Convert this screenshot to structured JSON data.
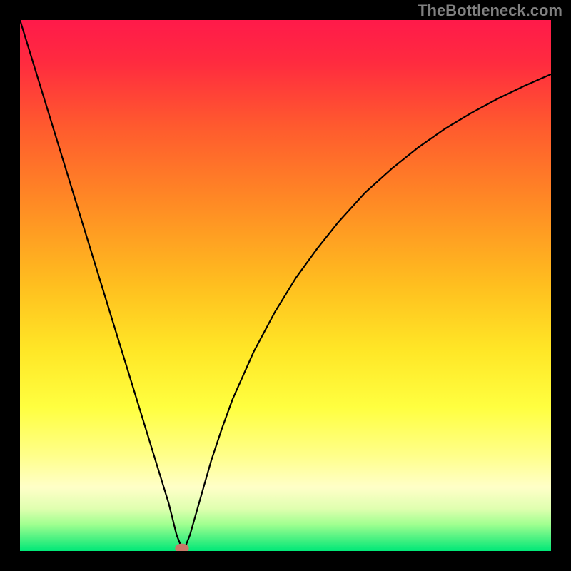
{
  "watermark": "TheBottleneck.com",
  "chart_data": {
    "type": "line",
    "title": "",
    "xlabel": "",
    "ylabel": "",
    "xlim": [
      0,
      100
    ],
    "ylim": [
      0,
      100
    ],
    "gradient_stops": [
      {
        "offset": 0.0,
        "color": "#ff1a4a"
      },
      {
        "offset": 0.08,
        "color": "#ff2b3f"
      },
      {
        "offset": 0.2,
        "color": "#ff5a2e"
      },
      {
        "offset": 0.35,
        "color": "#ff8c24"
      },
      {
        "offset": 0.5,
        "color": "#ffbf1f"
      },
      {
        "offset": 0.62,
        "color": "#ffe626"
      },
      {
        "offset": 0.73,
        "color": "#ffff40"
      },
      {
        "offset": 0.82,
        "color": "#ffff8a"
      },
      {
        "offset": 0.88,
        "color": "#ffffc8"
      },
      {
        "offset": 0.92,
        "color": "#e0ffb0"
      },
      {
        "offset": 0.95,
        "color": "#a0ff90"
      },
      {
        "offset": 0.98,
        "color": "#40f080"
      },
      {
        "offset": 1.0,
        "color": "#00e878"
      }
    ],
    "series": [
      {
        "name": "bottleneck-curve",
        "color": "#000000",
        "x": [
          0,
          2,
          4,
          6,
          8,
          10,
          12,
          14,
          16,
          18,
          20,
          22,
          24,
          26,
          28,
          29.5,
          30.5,
          31,
          32,
          34,
          36,
          38,
          40,
          44,
          48,
          52,
          56,
          60,
          65,
          70,
          75,
          80,
          85,
          90,
          95,
          100
        ],
        "y": [
          100,
          93.5,
          87,
          80.5,
          74,
          67.5,
          61,
          54.5,
          48,
          41.5,
          35,
          28.5,
          22,
          15.5,
          9,
          3,
          0.5,
          0.5,
          3,
          10,
          17,
          23,
          28.5,
          37.5,
          45,
          51.5,
          57,
          62,
          67.5,
          72,
          76,
          79.5,
          82.5,
          85.2,
          87.6,
          89.8
        ]
      }
    ],
    "marker": {
      "x": 30.5,
      "y": 0.5,
      "color": "#c87868",
      "rx": 1.3,
      "ry": 0.9
    }
  }
}
